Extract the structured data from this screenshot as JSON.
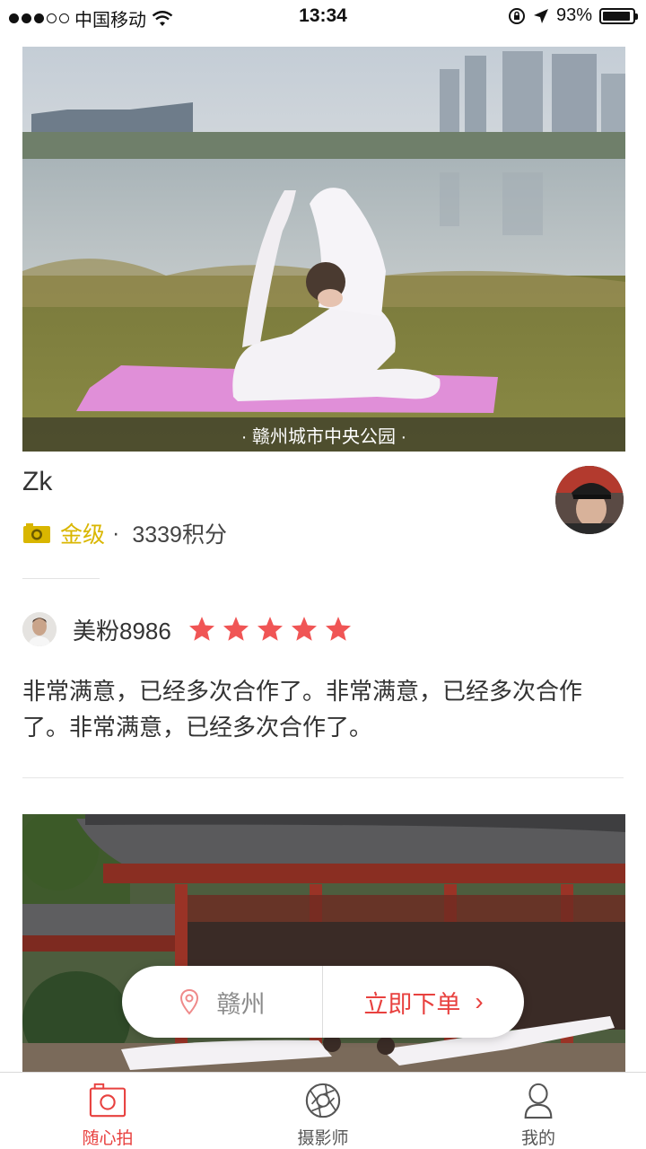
{
  "status_bar": {
    "carrier": "中国移动",
    "time": "13:34",
    "battery": "93%",
    "battery_level": 0.93
  },
  "post": {
    "location_caption": "· 赣州城市中央公园 ·",
    "photographer_name": "Zk",
    "level": "金级",
    "separator": "·",
    "points": "3339积分",
    "level_color": "#d9b600"
  },
  "review": {
    "reviewer": "美粉8986",
    "rating": 5,
    "text": "非常满意，已经多次合作了。非常满意，已经多次合作了。非常满意，已经多次合作了。",
    "star_color": "#f05555"
  },
  "action_pill": {
    "city": "赣州",
    "order_label": "立即下单",
    "order_arrow": "›",
    "accent": "#e8413f"
  },
  "tabbar": {
    "tabs": [
      {
        "label": "随心拍",
        "icon": "camera-frame-icon",
        "active": true
      },
      {
        "label": "摄影师",
        "icon": "aperture-icon",
        "active": false
      },
      {
        "label": "我的",
        "icon": "person-icon",
        "active": false
      }
    ]
  }
}
